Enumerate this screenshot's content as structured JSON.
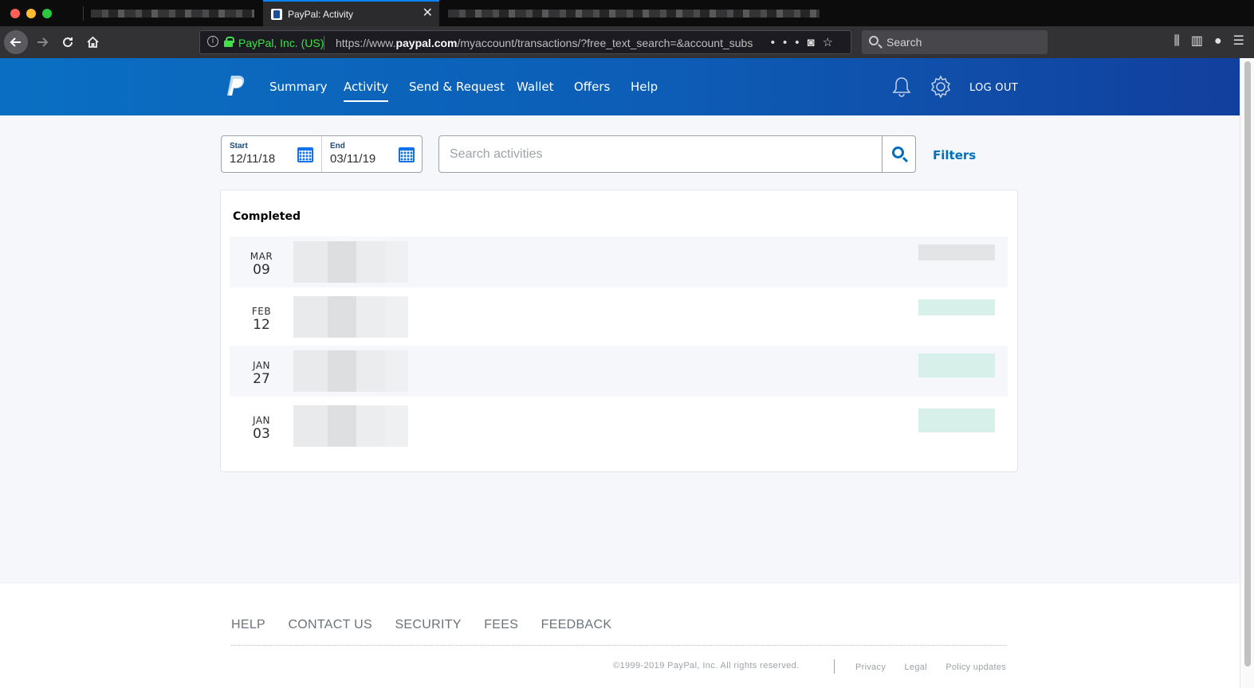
{
  "browser": {
    "active_tab_title": "PayPal: Activity",
    "tab_close": "✕",
    "url_org": "PayPal, Inc. (US)",
    "url_prefix": "https://www.",
    "url_domain": "paypal.com",
    "url_path": "/myaccount/transactions/?free_text_search=&account_subs",
    "search_placeholder": "Search"
  },
  "header": {
    "nav": [
      "Summary",
      "Activity",
      "Send & Request",
      "Wallet",
      "Offers",
      "Help"
    ],
    "active": "Activity",
    "logout": "LOG OUT"
  },
  "filters": {
    "start_label": "Start",
    "start_value": "12/11/18",
    "end_label": "End",
    "end_value": "03/11/19",
    "search_placeholder": "Search activities",
    "filters_label": "Filters"
  },
  "activity": {
    "section_title": "Completed",
    "rows": [
      {
        "month": "MAR",
        "day": "09"
      },
      {
        "month": "FEB",
        "day": "12"
      },
      {
        "month": "JAN",
        "day": "27"
      },
      {
        "month": "JAN",
        "day": "03"
      }
    ]
  },
  "footer": {
    "links": [
      "HELP",
      "CONTACT US",
      "SECURITY",
      "FEES",
      "FEEDBACK"
    ],
    "copyright": "©1999-2019 PayPal, Inc. All rights reserved.",
    "legal": [
      "Privacy",
      "Legal",
      "Policy updates"
    ]
  },
  "colors": {
    "brand_blue": "#0070ba",
    "header_gradient_start": "#0a6fc2",
    "header_gradient_end": "#123f9e",
    "secure_green": "#3fe04a"
  }
}
